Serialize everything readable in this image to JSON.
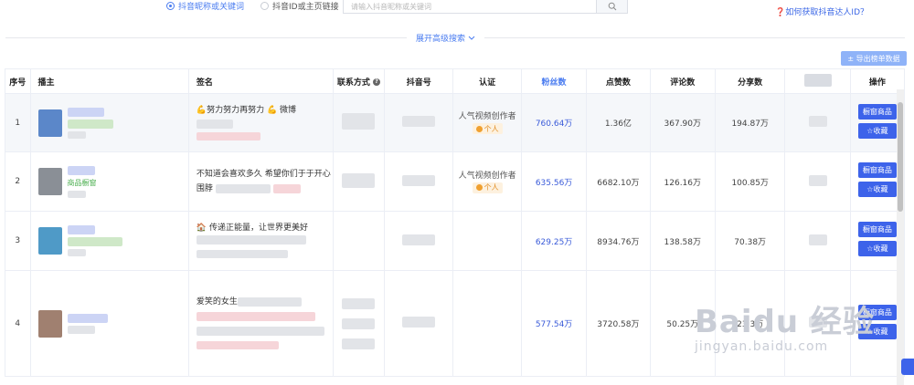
{
  "search": {
    "radio_nickname": "抖音昵称或关键词",
    "radio_id": "抖音ID或主页链接",
    "placeholder": "请输入抖音昵称或关键词",
    "help_link": "❓如何获取抖音达人ID？",
    "advanced": "展开高级搜索"
  },
  "toolbar": {
    "export_label": "± 导出榜单数据"
  },
  "table": {
    "headers": {
      "index": "序号",
      "streamer": "播主",
      "signature": "签名",
      "contact": "联系方式",
      "douyin_id": "抖音号",
      "cert": "认证",
      "fans": "粉丝数",
      "likes": "点赞数",
      "comments": "评论数",
      "shares": "分享数",
      "ops": "操作"
    },
    "rows": [
      {
        "index": "1",
        "signature": "💪努力努力再努力 💪 微博",
        "cert": "人气视频创作者",
        "cert_badge": "个人",
        "fans": "760.64万",
        "likes": "1.36亿",
        "comments": "367.90万",
        "shares": "194.87万"
      },
      {
        "index": "2",
        "streamer_tag": "商品橱窗",
        "signature": "不知道会喜欢多久 希望你们于于开心",
        "signature2": "围脖",
        "cert": "人气视频创作者",
        "cert_badge": "个人",
        "fans": "635.56万",
        "likes": "6682.10万",
        "comments": "126.16万",
        "shares": "100.85万"
      },
      {
        "index": "3",
        "signature": "🏠 传递正能量，让世界更美好",
        "fans": "629.25万",
        "likes": "8934.76万",
        "comments": "138.58万",
        "shares": "70.38万"
      },
      {
        "index": "4",
        "signature": "爱笑的女生",
        "fans": "577.54万",
        "likes": "3720.58万",
        "comments": "50.25万",
        "shares": "23.3万"
      }
    ],
    "btn_products": "橱窗商品",
    "btn_favorite": "☆收藏"
  },
  "watermark": {
    "line1": "Baidu 经验",
    "line2": "jingyan.baidu.com"
  },
  "colors": {
    "accent": "#3d63ea",
    "link": "#4a7cf0",
    "badge": "#e08a1e"
  }
}
